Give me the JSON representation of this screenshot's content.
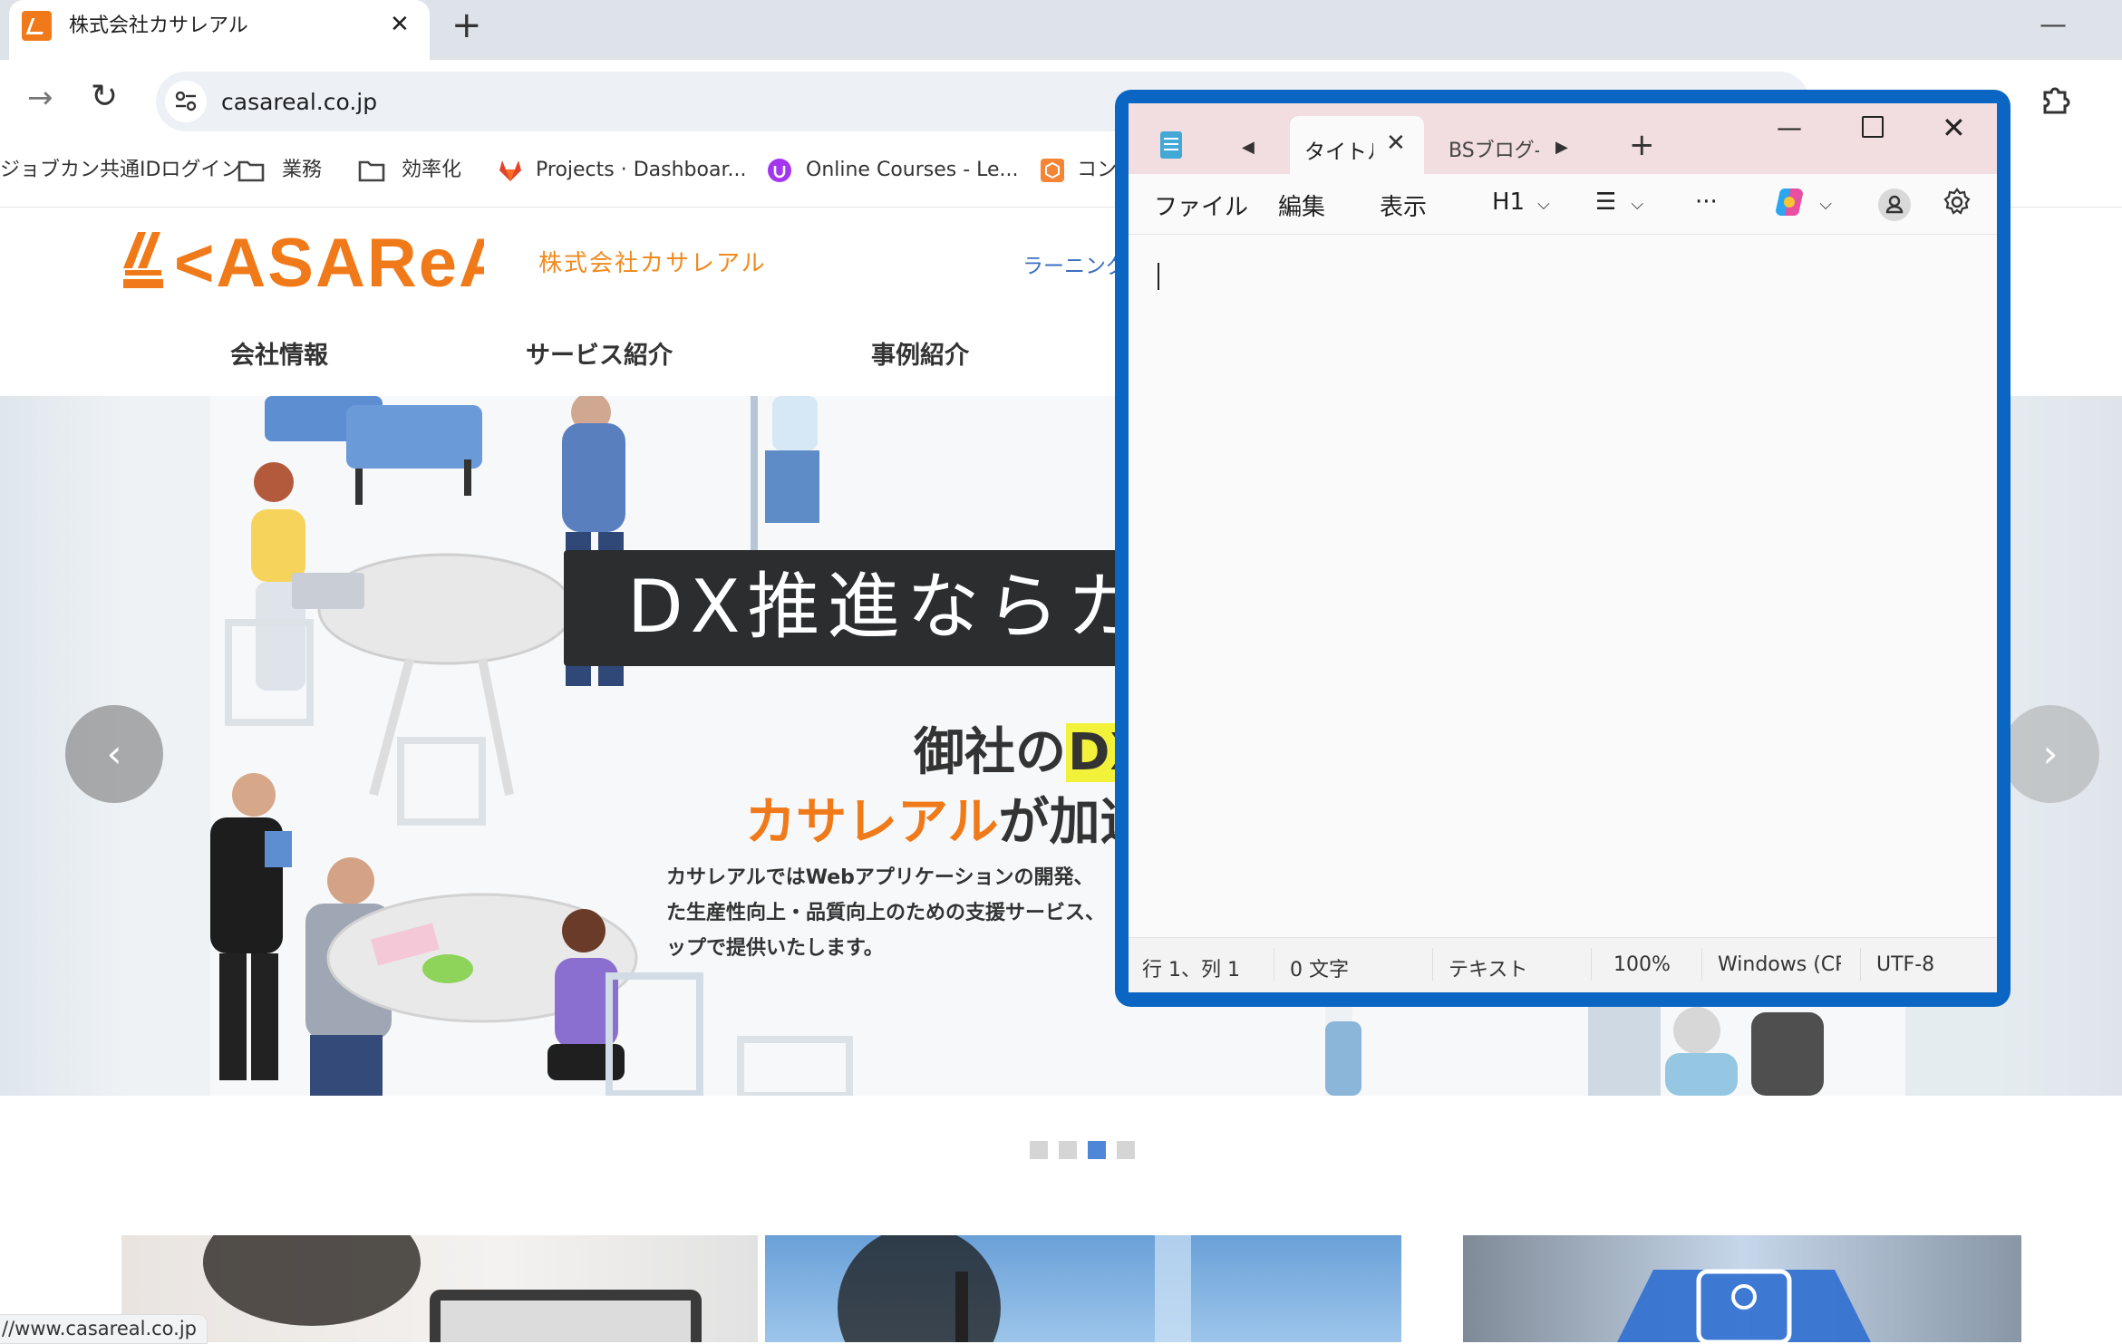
{
  "browser": {
    "tab_title": "株式会社カサレアル",
    "tab_close": "✕",
    "new_tab": "+",
    "url": "casareal.co.jp",
    "status_url": "//www.casareal.co.jp",
    "bookmarks": [
      {
        "label": "ジョブカン共通IDログイン",
        "icon": "none"
      },
      {
        "label": "業務",
        "icon": "folder-icon"
      },
      {
        "label": "効率化",
        "icon": "folder-icon"
      },
      {
        "label": "Projects · Dashboar...",
        "icon": "gitlab-icon"
      },
      {
        "label": "Online Courses - Le...",
        "icon": "udemy-icon"
      },
      {
        "label": "コンソ",
        "icon": "aws-icon"
      }
    ]
  },
  "site": {
    "company_name": "株式会社カサレアル",
    "learning_link": "ラーニング",
    "nav": [
      "会社情報",
      "サービス紹介",
      "事例紹介"
    ],
    "hero": {
      "banner": "DX推進ならカ",
      "line1_a": "御社の",
      "line1_hl": "DX",
      "line2_a": "カサレアル",
      "line2_b": "が加速",
      "desc": [
        "カサレアルではWebアプリケーションの開発、",
        "た生産性向上・品質向上のための支援サービス、",
        "ップで提供いたします。"
      ]
    },
    "carousel": {
      "prev": "‹",
      "next": "›",
      "dots": 4,
      "active": 3
    },
    "colors": {
      "brand": "#f07a1a",
      "link": "#3b6fc2"
    }
  },
  "notepad": {
    "tabs": [
      {
        "label": "タイトル",
        "active": true
      },
      {
        "label": "BSブログ-"
      }
    ],
    "menu": [
      "ファイル",
      "編集",
      "表示"
    ],
    "format": {
      "heading": "H1",
      "more": "···"
    },
    "status": {
      "position": "行 1、列 1",
      "chars": "0 文字",
      "mode": "テキスト",
      "zoom": "100%",
      "line_ending": "Windows (CRLF)",
      "encoding": "UTF-8"
    },
    "colors": {
      "frame": "#0a66c2",
      "titlebar": "#f2dde0"
    }
  }
}
